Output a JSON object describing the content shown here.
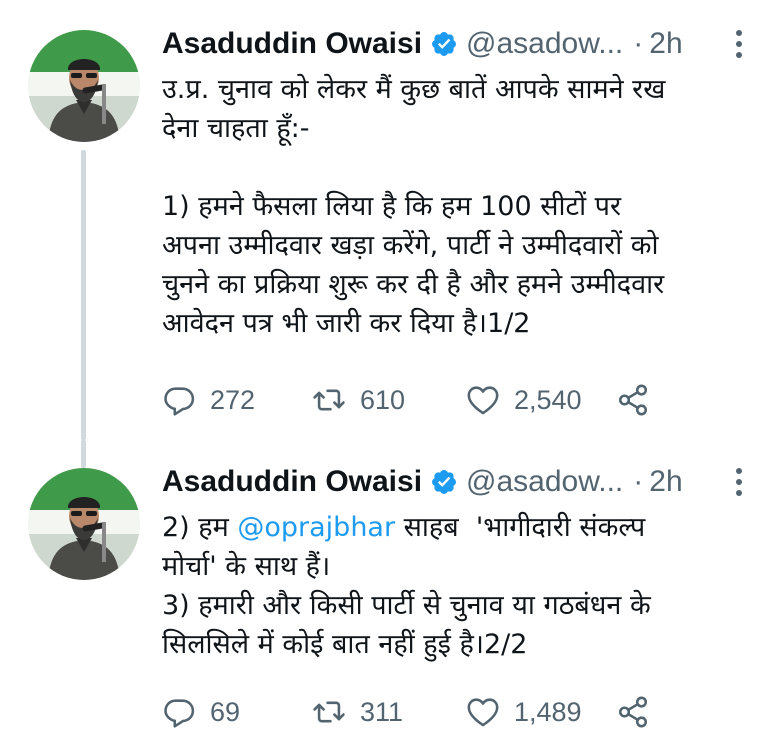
{
  "tweets": [
    {
      "name": "Asaduddin Owaisi",
      "handle": "@asadow...",
      "separator": "·",
      "time": "2h",
      "lines": [
        "उ.प्र. चुनाव को लेकर मैं कुछ बातें आपके सामने रख",
        "देना चाहता हूँ:-",
        "",
        "1) हमने फैसला लिया है कि हम 100 सीटों पर",
        "अपना उम्मीदवार खड़ा करेंगे, पार्टी ने उम्मीदवारों को",
        "चुनने का प्रक्रिया शुरू कर दी है और हमने उम्मीदवार",
        "आवेदन पत्र भी जारी कर दिया है।1/2"
      ],
      "replies": "272",
      "retweets": "610",
      "likes": "2,540"
    },
    {
      "name": "Asaduddin Owaisi",
      "handle": "@asadow...",
      "separator": "·",
      "time": "2h",
      "line1_pre": "2) हम ",
      "mention": "@oprajbhar",
      "line1_post": " साहब  'भागीदारी संकल्प",
      "lines": [
        "मोर्चा' के साथ हैं।",
        "3) हमारी और किसी पार्टी से चुनाव या गठबंधन के",
        "सिलसिले में कोई बात नहीं हुई है।2/2"
      ],
      "replies": "69",
      "retweets": "311",
      "likes": "1,489"
    }
  ],
  "colors": {
    "verified": "#1d9bf0",
    "mention": "#1d9bf0",
    "muted": "#536471",
    "thread_line": "#cfd9de"
  },
  "icons": [
    "verified-badge-icon",
    "more-options-icon",
    "reply-icon",
    "retweet-icon",
    "like-icon",
    "share-icon"
  ]
}
